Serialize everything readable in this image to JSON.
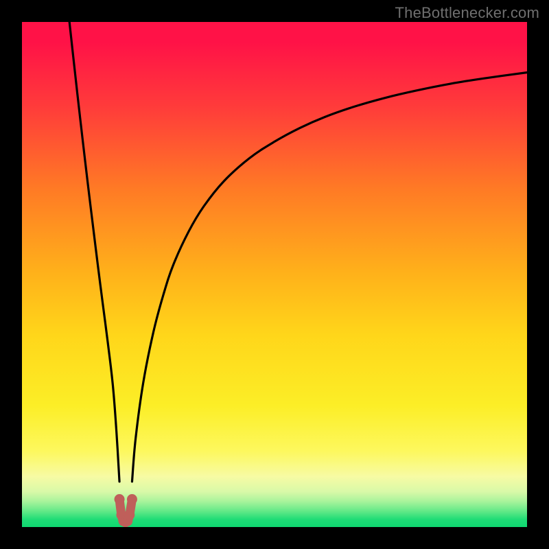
{
  "watermark": "TheBottlenecker.com",
  "layout": {
    "outer_width": 800,
    "outer_height": 800,
    "plot_margin": 32
  },
  "colors": {
    "frame": "#000000",
    "curve": "#000000",
    "marker_fill": "#bf5f5a",
    "marker_stroke": "#8e3d37",
    "gradient_stops": [
      "#ff1247",
      "#ff3c3a",
      "#ff7a25",
      "#ffb21a",
      "#ffd61a",
      "#fcee27",
      "#fdf85e",
      "#f7fba4",
      "#d9f9a8",
      "#a6f39b",
      "#5de886",
      "#1fdc76",
      "#0fd871"
    ]
  },
  "chart_data": {
    "type": "line",
    "title": "",
    "xlabel": "",
    "ylabel": "",
    "xlim": [
      0,
      100
    ],
    "ylim": [
      0,
      100
    ],
    "notch_x": 20.5,
    "series": [
      {
        "name": "left-branch",
        "x": [
          9.4,
          10,
          11,
          12,
          13,
          14,
          15,
          16,
          17,
          18,
          18.7,
          19.3
        ],
        "y": [
          100,
          94.5,
          85.5,
          76.8,
          68.3,
          60.1,
          52.0,
          44.2,
          36.5,
          28.0,
          19.0,
          9.0
        ]
      },
      {
        "name": "right-branch",
        "x": [
          21.8,
          22.5,
          24,
          26,
          28,
          30,
          33,
          36,
          40,
          45,
          50,
          55,
          60,
          66,
          72,
          78,
          85,
          92,
          100
        ],
        "y": [
          9.0,
          17.5,
          28.5,
          38.5,
          46.0,
          52.0,
          58.5,
          63.5,
          68.5,
          73.0,
          76.3,
          79.0,
          81.2,
          83.3,
          85.0,
          86.4,
          87.8,
          88.9,
          90.0
        ]
      }
    ],
    "notch": {
      "name": "notch-marker",
      "type": "marker",
      "x": [
        19.3,
        19.7,
        20.1,
        20.5,
        20.9,
        21.3,
        21.8
      ],
      "y": [
        5.5,
        2.4,
        1.2,
        1.0,
        1.2,
        2.4,
        5.5
      ]
    }
  }
}
